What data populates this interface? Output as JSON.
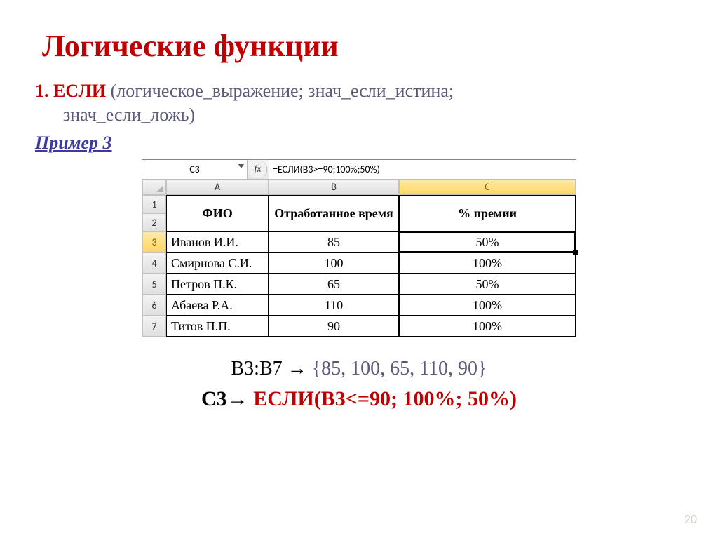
{
  "title": "Логические функции",
  "syntax": {
    "num": "1.",
    "fn": "ЕСЛИ",
    "rest1": " (логическое_выражение; знач_если_истина;",
    "rest2": "знач_если_ложь)"
  },
  "example_label": "Пример 3",
  "excel": {
    "namebox": "C3",
    "fx_label": "fx",
    "formula": "=ЕСЛИ(B3>=90;100%;50%)",
    "col_headers": [
      "A",
      "B",
      "C"
    ],
    "header_row": {
      "a": "ФИО",
      "b": "Отработанное время",
      "c": "% премии"
    },
    "rows": [
      {
        "n": "3",
        "a": "Иванов И.И.",
        "b": "85",
        "c": "50%"
      },
      {
        "n": "4",
        "a": "Смирнова С.И.",
        "b": "100",
        "c": "100%"
      },
      {
        "n": "5",
        "a": "Петров П.К.",
        "b": "65",
        "c": "50%"
      },
      {
        "n": "6",
        "a": "Абаева Р.А.",
        "b": "110",
        "c": "100%"
      },
      {
        "n": "7",
        "a": "Титов П.П.",
        "b": "90",
        "c": "100%"
      }
    ],
    "row_head_1": "1",
    "row_head_2": "2"
  },
  "bottom": {
    "line1_ref": "B3:B7 ",
    "line1_arrow": "→",
    "line1_vals": " {85, 100, 65, 110, 90}",
    "line2_ref": "C3",
    "line2_arrow": "→",
    "line2_expr": " ЕСЛИ(B3<=90; 100%; 50%)"
  },
  "page_number": "20"
}
